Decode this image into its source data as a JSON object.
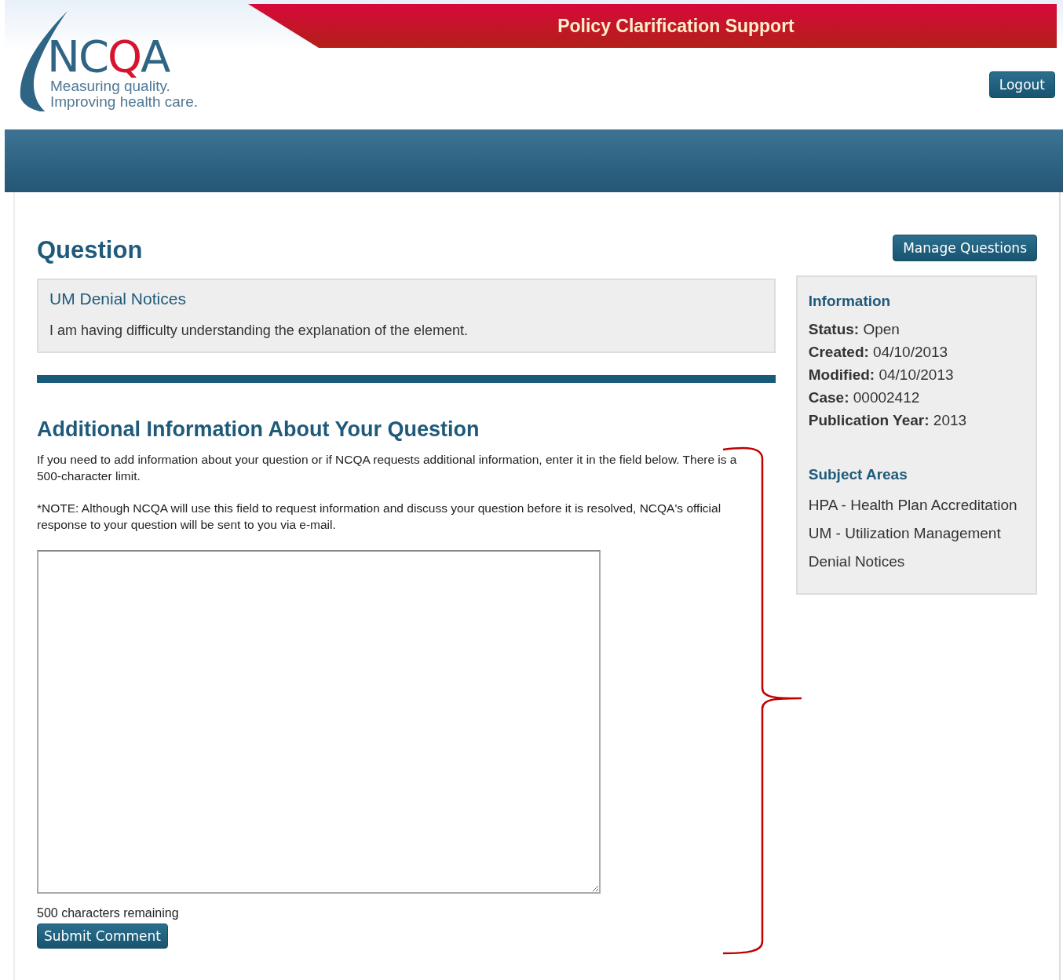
{
  "header": {
    "banner_title": "Policy Clarification Support",
    "logo": {
      "parts": [
        {
          "text": "NC",
          "color": "#2e6584"
        },
        {
          "text": "Q",
          "color": "#d7142e"
        },
        {
          "text": "A",
          "color": "#2e6584"
        }
      ],
      "tagline": [
        "Measuring quality.",
        "Improving health care."
      ]
    },
    "logout_button": "Logout"
  },
  "page_title": "Question",
  "manage_button": "Manage Questions",
  "question": {
    "title": "UM Denial Notices",
    "body": "I am having difficulty understanding the explanation of the element."
  },
  "additional": {
    "heading": "Additional Information About Your Question",
    "paragraphs": [
      "If you need to add information about your question or if NCQA requests additional information, enter it in the field below. There is a 500-character limit.",
      "*NOTE: Although NCQA will use this field to request information and discuss your question before it is resolved, NCQA's official response to your question will be sent to you via e-mail."
    ],
    "remaining": "500 characters remaining",
    "submit_button": "Submit Comment"
  },
  "sidebar": {
    "info_heading": "Information",
    "fields": [
      {
        "label": "Status:",
        "value": "Open"
      },
      {
        "label": "Created:",
        "value": "04/10/2013"
      },
      {
        "label": "Modified:",
        "value": "04/10/2013"
      },
      {
        "label": "Case:",
        "value": "00002412"
      },
      {
        "label": "Publication Year:",
        "value": "2013"
      }
    ],
    "subject_heading": "Subject Areas",
    "subjects": [
      "HPA - Health Plan Accreditation",
      "UM - Utilization Management",
      "Denial Notices"
    ]
  }
}
